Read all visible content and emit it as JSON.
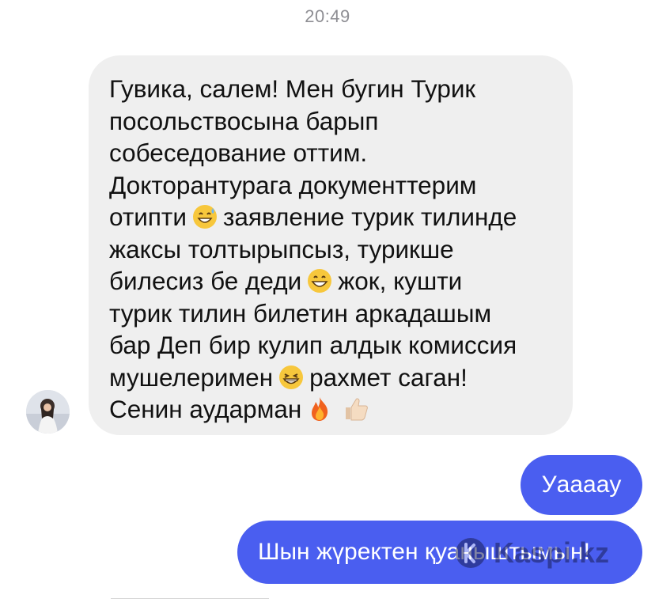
{
  "header": {
    "timestamp": "20:49"
  },
  "conversation": {
    "incoming": {
      "avatar_icon": "contact-avatar",
      "lines": [
        {
          "text": "Гувика, салем! Мен бугин Турик"
        },
        {
          "text": "посольствосына барып"
        },
        {
          "text": "собеседование оттим."
        },
        {
          "text": "Докторантурага документтерим"
        },
        {
          "before": "отипти",
          "emoji": "grinning-sweat-emoji",
          "after": "заявление турик тилинде"
        },
        {
          "text": "жаксы толтырыпсыз, турикше"
        },
        {
          "before": "билесиз бе деди",
          "emoji": "grinning-emoji",
          "after": "жок, кушти"
        },
        {
          "text": "турик тилин билетин аркадашым"
        },
        {
          "text": "бар Деп бир кулип алдык комиссия"
        },
        {
          "before": "мушелеримен",
          "emoji": "beaming-emoji",
          "after": "рахмет саган!"
        },
        {
          "before": "Сенин аударман",
          "emoji": "fire-emoji",
          "emoji2": "thumbs-up-emoji"
        }
      ]
    },
    "outgoing": [
      {
        "text": "Уааааy"
      },
      {
        "text": "Шын жүректен қуаныштымын!"
      }
    ]
  },
  "watermark": {
    "text": "Kaspi.kz"
  },
  "colors": {
    "incoming_bubble": "#efefef",
    "outgoing_bubble": "#4a5ef0",
    "timestamp": "#8e8e93"
  }
}
